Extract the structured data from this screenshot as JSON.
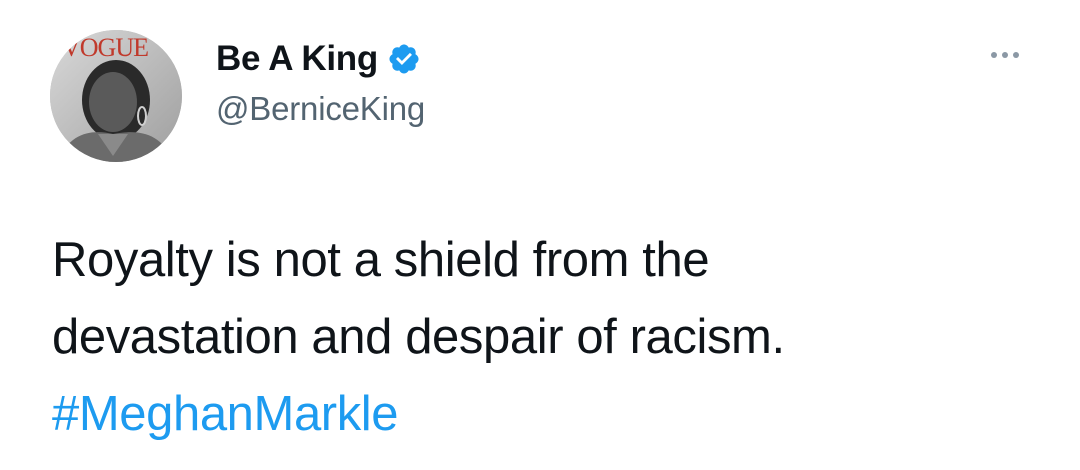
{
  "author": {
    "display_name": "Be A King",
    "handle": "@BerniceKing",
    "verified": true,
    "avatar_caption": "VOGUE"
  },
  "tweet": {
    "text_line_1": "Royalty is not a shield from the",
    "text_line_2": "devastation and despair of racism.",
    "hashtag": "#MeghanMarkle"
  },
  "icons": {
    "verified": "verified-badge-icon",
    "more": "more-options-icon"
  },
  "colors": {
    "link": "#1d9bf0",
    "handle": "#536471",
    "text": "#0f1419",
    "verified": "#1d9bf0",
    "avatar_logo": "#c0392b"
  }
}
